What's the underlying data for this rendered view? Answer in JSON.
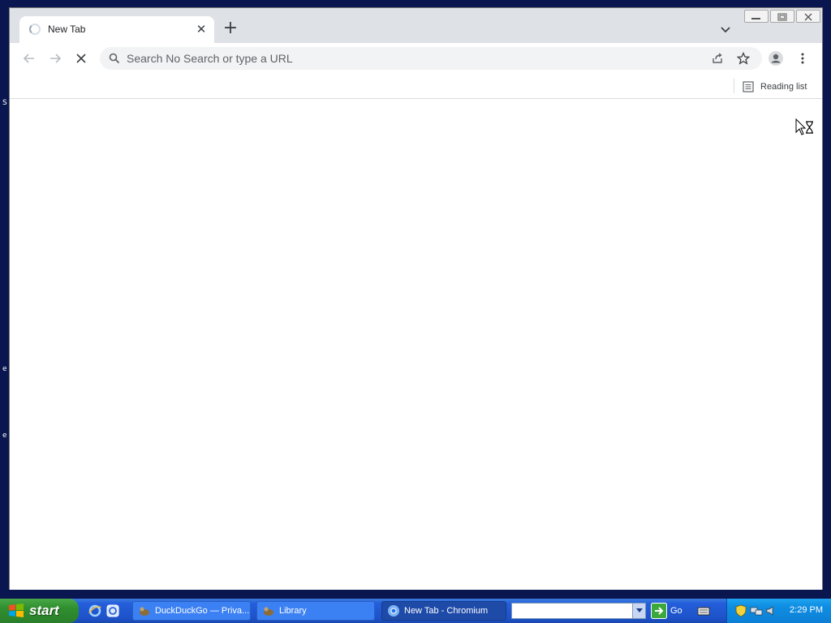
{
  "desktop": {
    "edge_chars": [
      "S",
      "e",
      "e"
    ]
  },
  "browser": {
    "tab": {
      "title": "New Tab",
      "close_glyph": "✕",
      "loading": true
    },
    "new_tab_glyph": "+",
    "omnibox": {
      "placeholder": "Search No Search or type a URL",
      "value": ""
    },
    "bookmarks_bar": {
      "reading_list_label": "Reading list"
    },
    "icons": {
      "back": "arrow-left",
      "forward": "arrow-right",
      "stop": "close",
      "search": "magnifier",
      "share": "share",
      "bookmark": "star",
      "profile": "person-circle",
      "menu": "vertical-dots",
      "tab_search": "chevron-down"
    }
  },
  "taskbar": {
    "start_label": "start",
    "tasks": [
      {
        "label": "DuckDuckGo — Priva...",
        "active": false
      },
      {
        "label": "Library",
        "active": false
      },
      {
        "label": "New Tab - Chromium",
        "active": true
      }
    ],
    "address_value": "",
    "go_label": "Go",
    "clock": "2:29 PM"
  },
  "colors": {
    "desktop_bg": "#0a1650",
    "tabstrip_bg": "#dee1e6",
    "omnibox_bg": "#f1f3f4",
    "taskbar_blue": "#245edb",
    "start_green": "#2f8f2f",
    "tray_blue": "#0f8ee3"
  }
}
